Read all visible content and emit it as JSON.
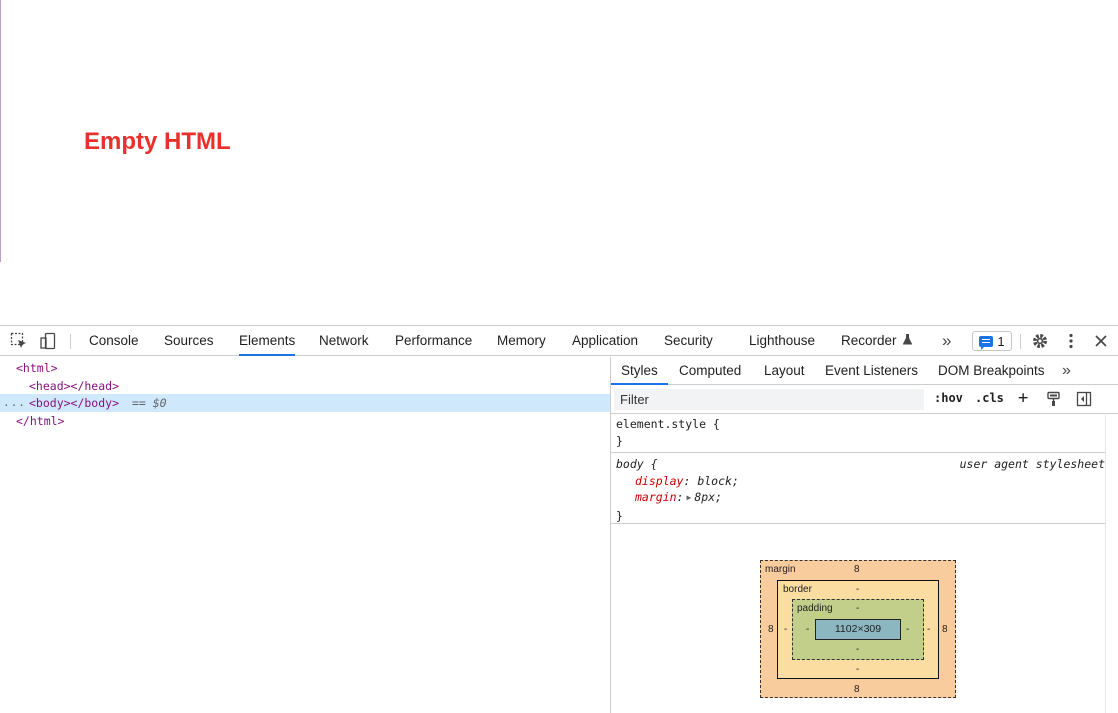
{
  "page": {
    "heading": "Empty HTML",
    "heading_color": "#e8312c"
  },
  "devtools": {
    "tabs": [
      "Console",
      "Sources",
      "Elements",
      "Network",
      "Performance",
      "Memory",
      "Application",
      "Security",
      "Lighthouse",
      "Recorder"
    ],
    "active_tab": "Elements",
    "more_tabs_glyph": "»",
    "issues_count": "1",
    "accent_color": "#1a73e8",
    "close_glyph": "✕"
  },
  "elements_tree": {
    "lines": [
      "<html>",
      "<head></head>",
      "<body></body>",
      "</html>"
    ],
    "selected_marker": "== $0",
    "ellipsis": "..."
  },
  "styles_pane": {
    "subtabs": [
      "Styles",
      "Computed",
      "Layout",
      "Event Listeners",
      "DOM Breakpoints"
    ],
    "active_subtab": "Styles",
    "more_glyph": "»",
    "filter_placeholder": "Filter",
    "hov_label": ":hov",
    "cls_label": ".cls",
    "plus_label": "+",
    "rules": {
      "element_style": {
        "selector": "element.style {",
        "close": "}"
      },
      "body": {
        "selector": "body {",
        "source": "user agent stylesheet",
        "props": [
          {
            "name": "display",
            "value": "block;"
          },
          {
            "name": "margin",
            "value": "8px;"
          }
        ],
        "close": "}"
      }
    }
  },
  "box_model": {
    "margin_label": "margin",
    "margin_top": "8",
    "margin_bottom": "8",
    "margin_left": "8",
    "margin_right": "8",
    "border_label": "border",
    "border_top": "-",
    "border_bottom": "-",
    "border_left": "-",
    "border_right": "-",
    "padding_label": "padding",
    "padding_top": "-",
    "padding_bottom": "-",
    "padding_left": "-",
    "padding_right": "-",
    "content_size": "1102×309"
  }
}
